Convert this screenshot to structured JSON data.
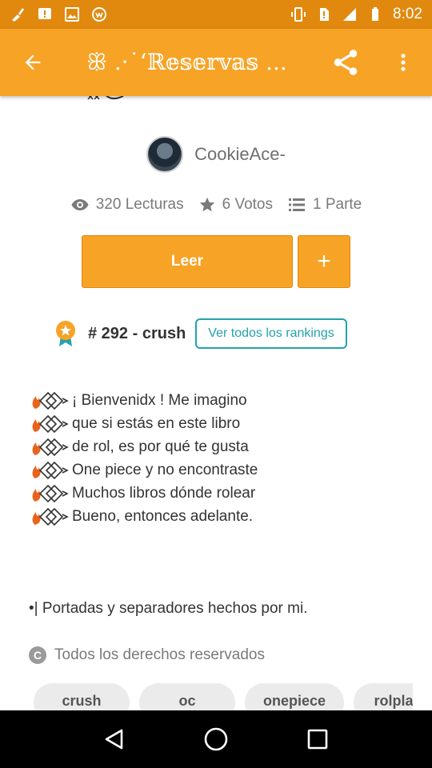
{
  "status_bar": {
    "time": "8:02",
    "icons_left": [
      "broom-icon",
      "alert-icon",
      "image-icon",
      "wattpad-icon"
    ],
    "icons_right": [
      "vibrate-icon",
      "no-sim-icon",
      "signal-icon",
      "battery-icon"
    ]
  },
  "toolbar": {
    "title": "ꕥ .·˙‘ℝ𝕖𝕤𝕖𝕣𝕧𝕒𝕤 ...",
    "back_icon": "arrow-left-icon",
    "share_icon": "share-icon",
    "more_icon": "more-vert-icon"
  },
  "author": {
    "name": "CookieAce-"
  },
  "stats": {
    "reads": "320 Lecturas",
    "votes": "6 Votos",
    "parts": "1 Parte"
  },
  "actions": {
    "read_label": "Leer",
    "add_label": "+"
  },
  "ranking": {
    "text": "# 292 - crush",
    "link_label": "Ver todos los rankings"
  },
  "description": {
    "lines": [
      "¡ Bienvenidx ! Me imagino",
      "que si estás en este libro",
      "de rol, es por qué te gusta",
      "One piece y no encontraste",
      "Muchos libros dónde rolear",
      "Bueno, entonces adelante."
    ],
    "note": "•| Portadas y separadores hechos por mi."
  },
  "copyright": {
    "text": "Todos los derechos reservados",
    "icon_label": "C"
  },
  "tags": [
    "crush",
    "oc",
    "onepiece",
    "rolpla"
  ],
  "colors": {
    "primary": "#F7A326",
    "status": "#E0890E",
    "teal": "#23A3AB"
  }
}
